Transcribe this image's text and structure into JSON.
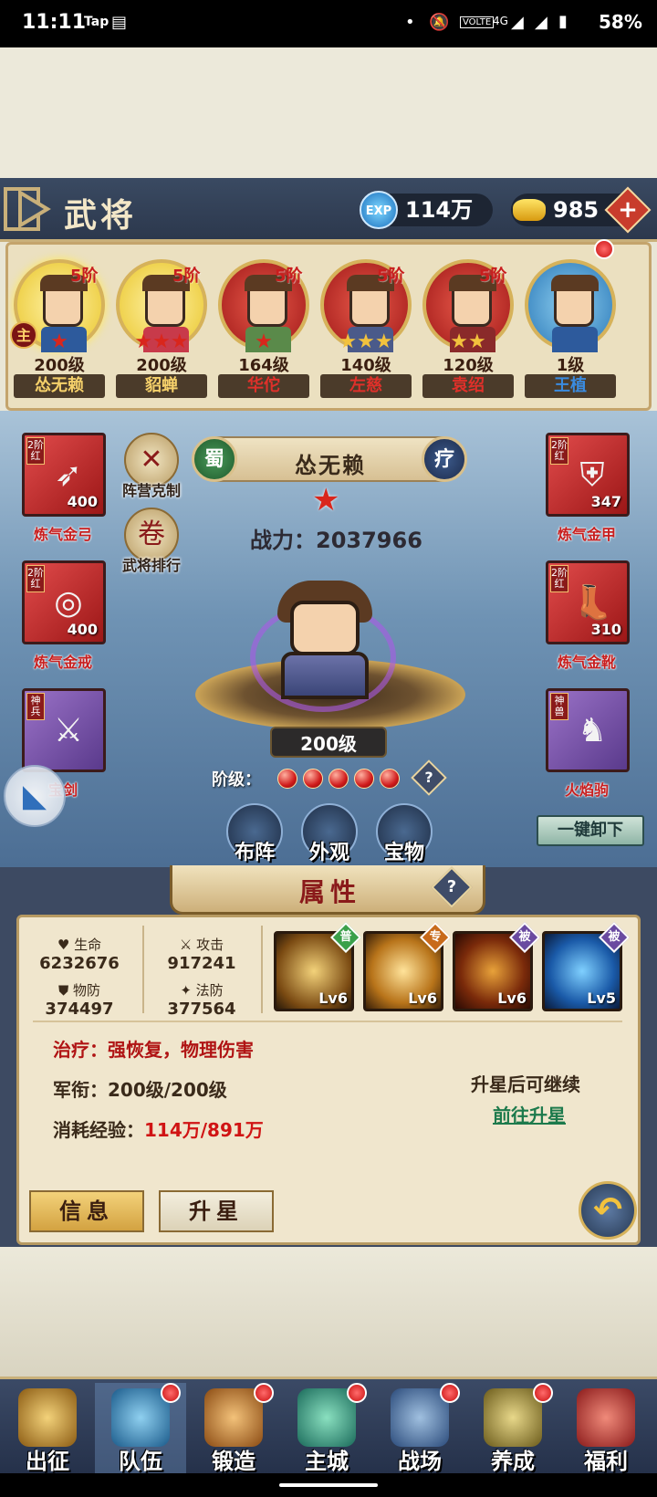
{
  "status_bar": {
    "time": "11:11",
    "app_tag": "Tap",
    "battery": "58%",
    "network": "4G",
    "volte": "VOLTE"
  },
  "header": {
    "title": "武将",
    "exp_icon_text": "EXP",
    "exp": "114万",
    "gold": "985",
    "plus": "+"
  },
  "heroes": [
    {
      "name": "怂无赖",
      "level": "200级",
      "stage": "5阶",
      "stars": "★",
      "lord_badge": "主",
      "name_color": "#f5d06a"
    },
    {
      "name": "貂蝉",
      "level": "200级",
      "stage": "5阶",
      "stars": "★★★",
      "name_color": "#f5d06a"
    },
    {
      "name": "华佗",
      "level": "164级",
      "stage": "5阶",
      "stars": "★",
      "name_color": "#e0302a"
    },
    {
      "name": "左慈",
      "level": "140级",
      "stage": "5阶",
      "stars": "★★★",
      "name_color": "#e0302a"
    },
    {
      "name": "袁绍",
      "level": "120级",
      "stage": "5阶",
      "stars": "★★",
      "name_color": "#e0302a"
    },
    {
      "name": "王植",
      "level": "1级",
      "stage": "",
      "stars": "",
      "name_color": "#3a8be0"
    }
  ],
  "side_buttons": {
    "camp": "阵营克制",
    "ranking": "武将排行"
  },
  "equipment": {
    "bow": {
      "tag": "2阶红",
      "count": "400",
      "label": "炼气金弓"
    },
    "ring": {
      "tag": "2阶红",
      "count": "400",
      "label": "炼气金戒"
    },
    "sword": {
      "tag": "神兵",
      "count": "",
      "label": "宝剑"
    },
    "armor": {
      "tag": "2阶红",
      "count": "347",
      "label": "炼气金甲"
    },
    "boots": {
      "tag": "2阶红",
      "count": "310",
      "label": "炼气金靴"
    },
    "mount": {
      "tag": "神兽",
      "count": "",
      "label": "火焰驹"
    }
  },
  "hero_detail": {
    "faction": "蜀",
    "role": "疗",
    "name": "怂无赖",
    "power_label": "战力：",
    "power": "2037966",
    "level": "200级",
    "rank_label": "阶级：",
    "rank_gems": 5,
    "help": "?"
  },
  "actions": {
    "formation": "布阵",
    "appearance": "外观",
    "treasure": "宝物",
    "unequip_all": "一键卸下"
  },
  "attributes": {
    "tab_title": "属性",
    "hp_label": "生命",
    "hp": "6232676",
    "atk_label": "攻击",
    "atk": "917241",
    "pdef_label": "物防",
    "pdef": "374497",
    "mdef_label": "法防",
    "mdef": "377564",
    "skills": [
      {
        "level": "Lv6",
        "badge": "普",
        "badge_color": "#3aa04a"
      },
      {
        "level": "Lv6",
        "badge": "专",
        "badge_color": "#c86a1a"
      },
      {
        "level": "Lv6",
        "badge": "被",
        "badge_color": "#6a4aa0"
      },
      {
        "level": "Lv5",
        "badge": "被",
        "badge_color": "#6a4aa0"
      }
    ],
    "role_desc": "治疗：强恢复，物理伤害",
    "rank_line": "军衔：200级/200级",
    "exp_label": "消耗经验：",
    "exp_value": "114万/891万",
    "note": "升星后可继续",
    "go_star": "前往升星",
    "tab_info": "信息",
    "tab_star": "升星",
    "return_icon": "↶"
  },
  "nav": [
    {
      "label": "出征",
      "color": "#c9a043",
      "dot": false
    },
    {
      "label": "队伍",
      "color": "#4aa0c9",
      "dot": true
    },
    {
      "label": "锻造",
      "color": "#c98a43",
      "dot": true
    },
    {
      "label": "主城",
      "color": "#43a08a",
      "dot": true
    },
    {
      "label": "战场",
      "color": "#6a8ab0",
      "dot": true
    },
    {
      "label": "养成",
      "color": "#a0904a",
      "dot": true
    },
    {
      "label": "福利",
      "color": "#c04a4a",
      "dot": false
    }
  ]
}
